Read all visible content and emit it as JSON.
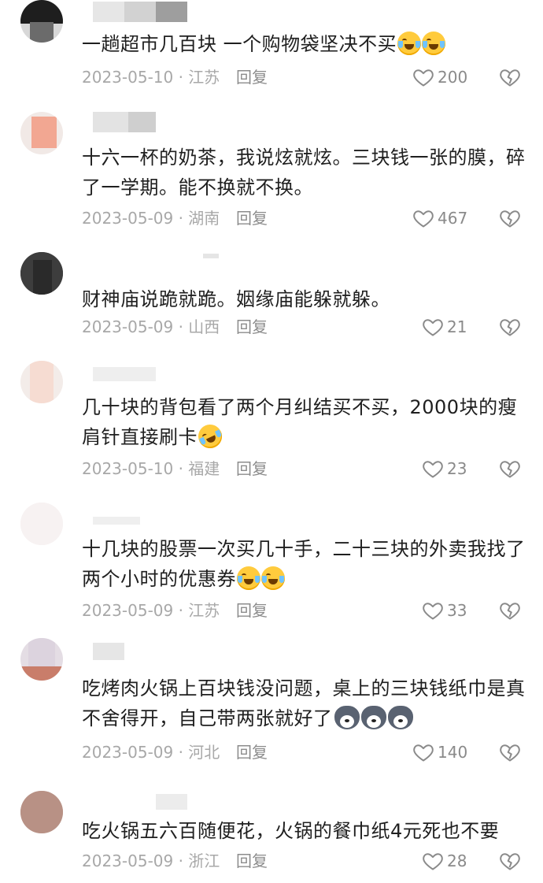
{
  "reply_label": "回复",
  "colors": {
    "text": "#1f1f1f",
    "meta": "#a8a8a8",
    "icon": "#8a8a8a"
  },
  "icons": {
    "like": "heart-outline-icon",
    "dislike": "broken-heart-icon"
  },
  "comments": [
    {
      "text": "一趟超市几百块 一个购物袋坚决不买",
      "emoji": [
        "laugh-cry",
        "laugh-cry"
      ],
      "date": "2023-05-10 · 江苏",
      "likes": "200"
    },
    {
      "text": "十六一杯的奶茶，我说炫就炫。三块钱一张的膜，碎了一学期。能不换就不换。",
      "emoji": [],
      "date": "2023-05-09 · 湖南",
      "likes": "467"
    },
    {
      "text": "财神庙说跪就跪。姻缘庙能躲就躲。",
      "emoji": [],
      "date": "2023-05-09 · 山西",
      "likes": "21"
    },
    {
      "text": "几十块的背包看了两个月纠结买不买，2000块的瘦肩针直接刷卡",
      "emoji": [
        "laugh-roll"
      ],
      "date": "2023-05-10 · 福建",
      "likes": "23"
    },
    {
      "text": "十几块的股票一次买几十手，二十三块的外卖我找了两个小时的优惠券",
      "emoji": [
        "laugh-cry",
        "laugh-cry"
      ],
      "date": "2023-05-09 · 江苏",
      "likes": "33"
    },
    {
      "text": "吃烤肉火锅上百块钱没问题，桌上的三块钱纸巾是真不舍得开，自己带两张就好了",
      "emoji": [
        "husky",
        "husky",
        "husky"
      ],
      "date": "2023-05-09 · 河北",
      "likes": "140"
    },
    {
      "text": "吃火锅五六百随便花，火锅的餐巾纸4元死也不要",
      "emoji": [],
      "date": "2023-05-09 · 浙江",
      "likes": "28"
    }
  ]
}
